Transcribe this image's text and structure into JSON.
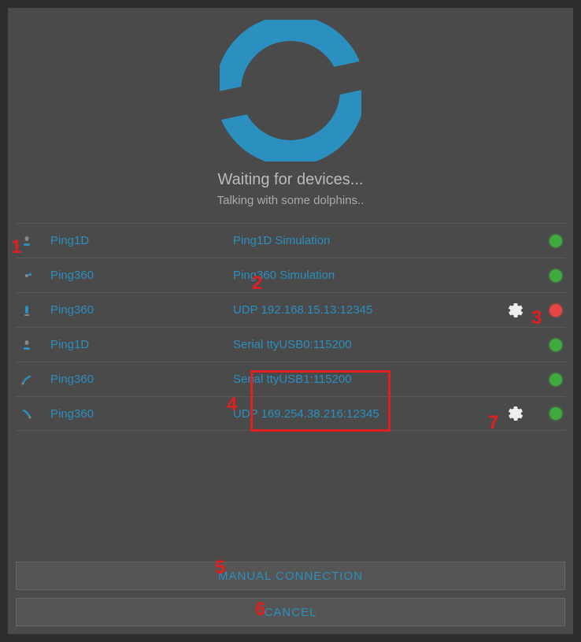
{
  "header": {
    "waiting": "Waiting for devices...",
    "subtitle": "Talking with some dolphins.."
  },
  "devices": [
    {
      "name": "Ping1D",
      "detail": "Ping1D Simulation",
      "status": "green",
      "gear": false
    },
    {
      "name": "Ping360",
      "detail": "Ping360 Simulation",
      "status": "green",
      "gear": false
    },
    {
      "name": "Ping360",
      "detail": "UDP 192.168.15.13:12345",
      "status": "red",
      "gear": true
    },
    {
      "name": "Ping1D",
      "detail": "Serial ttyUSB0:115200",
      "status": "green",
      "gear": false
    },
    {
      "name": "Ping360",
      "detail": "Serial ttyUSB1:115200",
      "status": "green",
      "gear": false
    },
    {
      "name": "Ping360",
      "detail": "UDP 169.254.38.216:12345",
      "status": "green",
      "gear": true
    }
  ],
  "buttons": {
    "manual": "MANUAL CONNECTION",
    "cancel": "CANCEL"
  },
  "annotations": {
    "a1": "1",
    "a2": "2",
    "a3": "3",
    "a4": "4",
    "a5": "5",
    "a6": "6",
    "a7": "7"
  }
}
